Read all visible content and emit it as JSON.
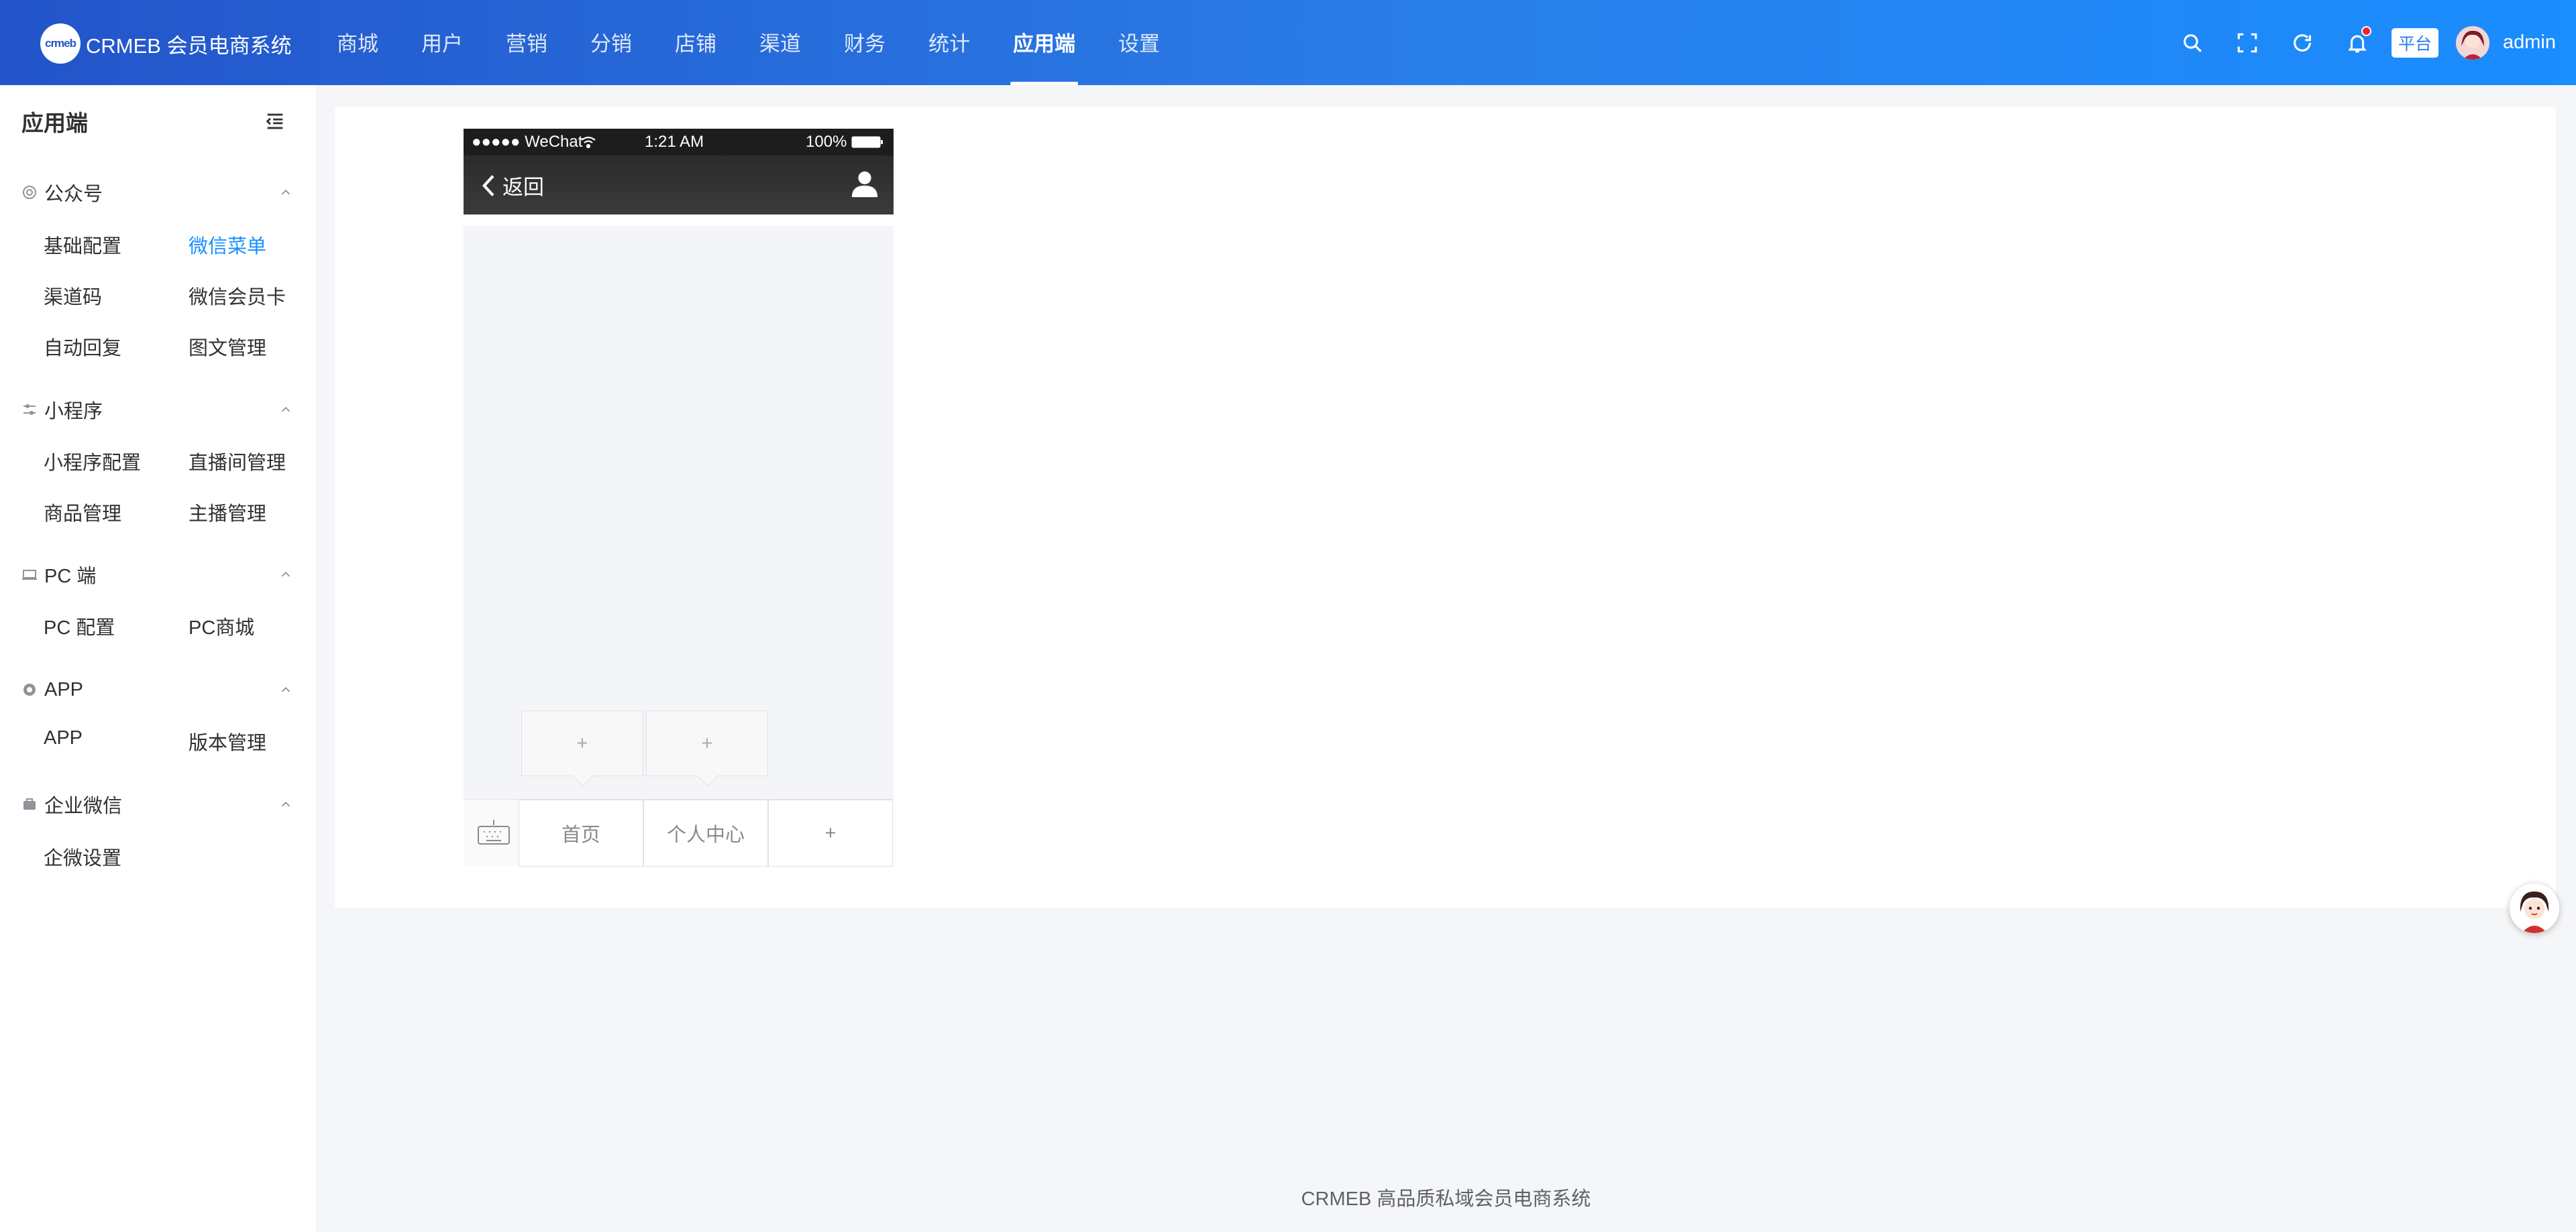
{
  "header": {
    "logo_mark": "crmeb",
    "logo_text": "CRMEB 会员电商系统",
    "nav": [
      {
        "label": "商城"
      },
      {
        "label": "用户"
      },
      {
        "label": "营销"
      },
      {
        "label": "分销"
      },
      {
        "label": "店铺"
      },
      {
        "label": "渠道"
      },
      {
        "label": "财务"
      },
      {
        "label": "统计"
      },
      {
        "label": "应用端",
        "active": true
      },
      {
        "label": "设置"
      }
    ],
    "icons": [
      "search-icon",
      "fullscreen-icon",
      "refresh-icon",
      "bell-icon"
    ],
    "platform_tag": "平台",
    "username": "admin"
  },
  "sidebar": {
    "title": "应用端",
    "groups": [
      {
        "label": "公众号",
        "icon": "wechat-official-icon",
        "items": [
          {
            "label": "基础配置"
          },
          {
            "label": "微信菜单",
            "active": true
          },
          {
            "label": "渠道码"
          },
          {
            "label": "微信会员卡"
          },
          {
            "label": "自动回复"
          },
          {
            "label": "图文管理"
          }
        ]
      },
      {
        "label": "小程序",
        "icon": "mini-program-icon",
        "items": [
          {
            "label": "小程序配置"
          },
          {
            "label": "直播间管理"
          },
          {
            "label": "商品管理"
          },
          {
            "label": "主播管理"
          }
        ]
      },
      {
        "label": "PC 端",
        "icon": "pc-icon",
        "items": [
          {
            "label": "PC 配置"
          },
          {
            "label": "PC商城"
          }
        ]
      },
      {
        "label": "APP",
        "icon": "app-icon",
        "items": [
          {
            "label": "APP"
          },
          {
            "label": "版本管理"
          }
        ]
      },
      {
        "label": "企业微信",
        "icon": "work-wechat-icon",
        "items": [
          {
            "label": "企微设置"
          }
        ]
      }
    ]
  },
  "phone": {
    "status": {
      "carrier": "●●●●● WeChat",
      "time": "1:21 AM",
      "battery": "100%"
    },
    "back_label": "返回",
    "menu": [
      {
        "label": "首页"
      },
      {
        "label": "个人中心"
      },
      {
        "label": "+"
      }
    ],
    "submenu_add": [
      "+",
      "+"
    ]
  },
  "footer": {
    "text": "CRMEB 高品质私域会员电商系统"
  },
  "colors": {
    "header_start": "#2354c9",
    "header_end": "#1a8dff",
    "active_link": "#1890ff"
  }
}
